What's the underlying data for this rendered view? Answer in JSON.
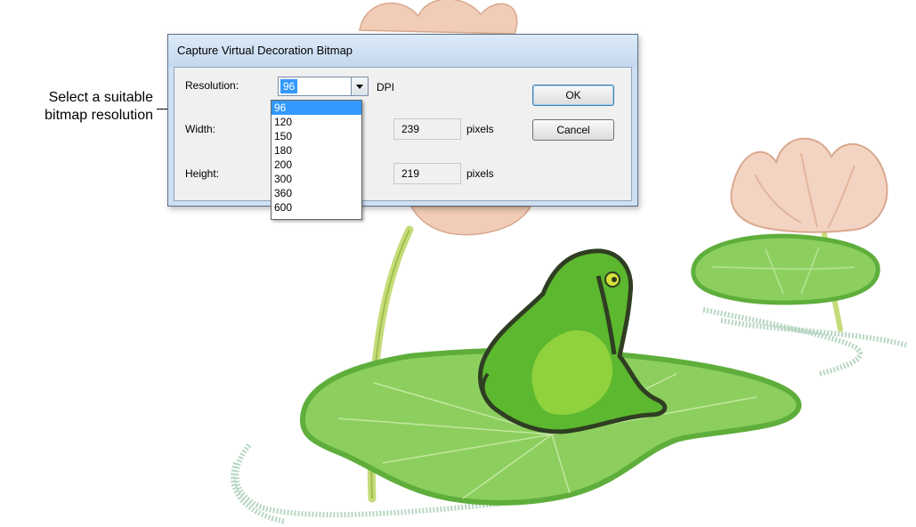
{
  "callout": {
    "line1": "Select a suitable",
    "line2": "bitmap resolution"
  },
  "dialog": {
    "title": "Capture Virtual Decoration Bitmap",
    "resolution_label": "Resolution:",
    "resolution_value": "96",
    "dpi_label": "DPI",
    "width_label": "Width:",
    "width_value": "239",
    "width_unit": "pixels",
    "height_label": "Height:",
    "height_value": "219",
    "height_unit": "pixels",
    "ok_label": "OK",
    "cancel_label": "Cancel"
  },
  "resolution_options": [
    "96",
    "120",
    "150",
    "180",
    "200",
    "300",
    "360",
    "600"
  ],
  "selected_option_index": 0,
  "colors": {
    "highlight": "#3399ff",
    "dialog_frame": "#cfe0f2",
    "lily_pad": "#8ccf5f",
    "lily_pad_outline": "#5fae3c",
    "frog": "#5cb82e",
    "lotus": "#f1cdb7"
  },
  "icons": [
    "dropdown-arrow-icon",
    "callout-arrow-icon"
  ]
}
